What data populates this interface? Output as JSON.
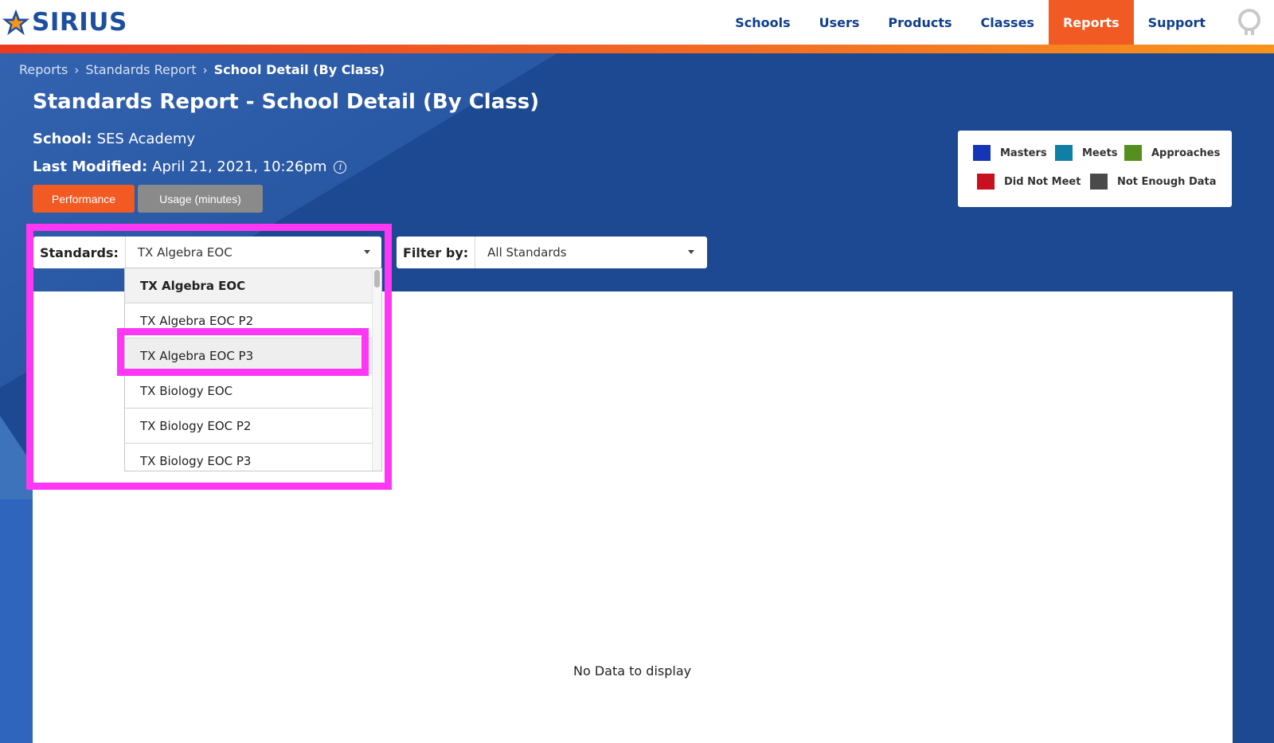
{
  "app": {
    "logo_text": "SIRIUS"
  },
  "nav": {
    "items": [
      {
        "label": "Schools"
      },
      {
        "label": "Users"
      },
      {
        "label": "Products"
      },
      {
        "label": "Classes"
      },
      {
        "label": "Reports",
        "active": true
      },
      {
        "label": "Support"
      }
    ]
  },
  "breadcrumb": {
    "items": [
      "Reports",
      "Standards Report",
      "School Detail (By Class)"
    ],
    "separator": "›"
  },
  "page": {
    "title": "Standards Report - School Detail (By Class)",
    "school_label": "School:",
    "school_value": "SES Academy",
    "modified_label": "Last Modified:",
    "modified_value": "April 21, 2021, 10:26pm",
    "info_glyph": "i"
  },
  "view_toggle": {
    "performance": "Performance",
    "usage": "Usage (minutes)"
  },
  "legend": {
    "items": [
      {
        "label": "Masters",
        "color": "#1436b4"
      },
      {
        "label": "Meets",
        "color": "#0f7fa6"
      },
      {
        "label": "Approaches",
        "color": "#55901e"
      },
      {
        "label": "Did Not Meet",
        "color": "#c8101e"
      },
      {
        "label": "Not Enough Data",
        "color": "#4a4a4a"
      }
    ]
  },
  "filters": {
    "standards_label": "Standards:",
    "standards_value": "TX Algebra EOC",
    "filter_label": "Filter by:",
    "filter_value": "All Standards"
  },
  "dropdown": {
    "options": [
      "TX Algebra EOC",
      "TX Algebra EOC P2",
      "TX Algebra EOC P3",
      "TX Biology EOC",
      "TX Biology EOC P2",
      "TX Biology EOC P3"
    ],
    "selected_option": "TX Algebra EOC",
    "highlighted_option": "TX Algebra EOC P3"
  },
  "content": {
    "empty_message": "No Data to display"
  },
  "colors": {
    "brand_blue": "#1c4992",
    "accent_orange": "#f15a22",
    "annotation_magenta": "#ff36f4"
  }
}
